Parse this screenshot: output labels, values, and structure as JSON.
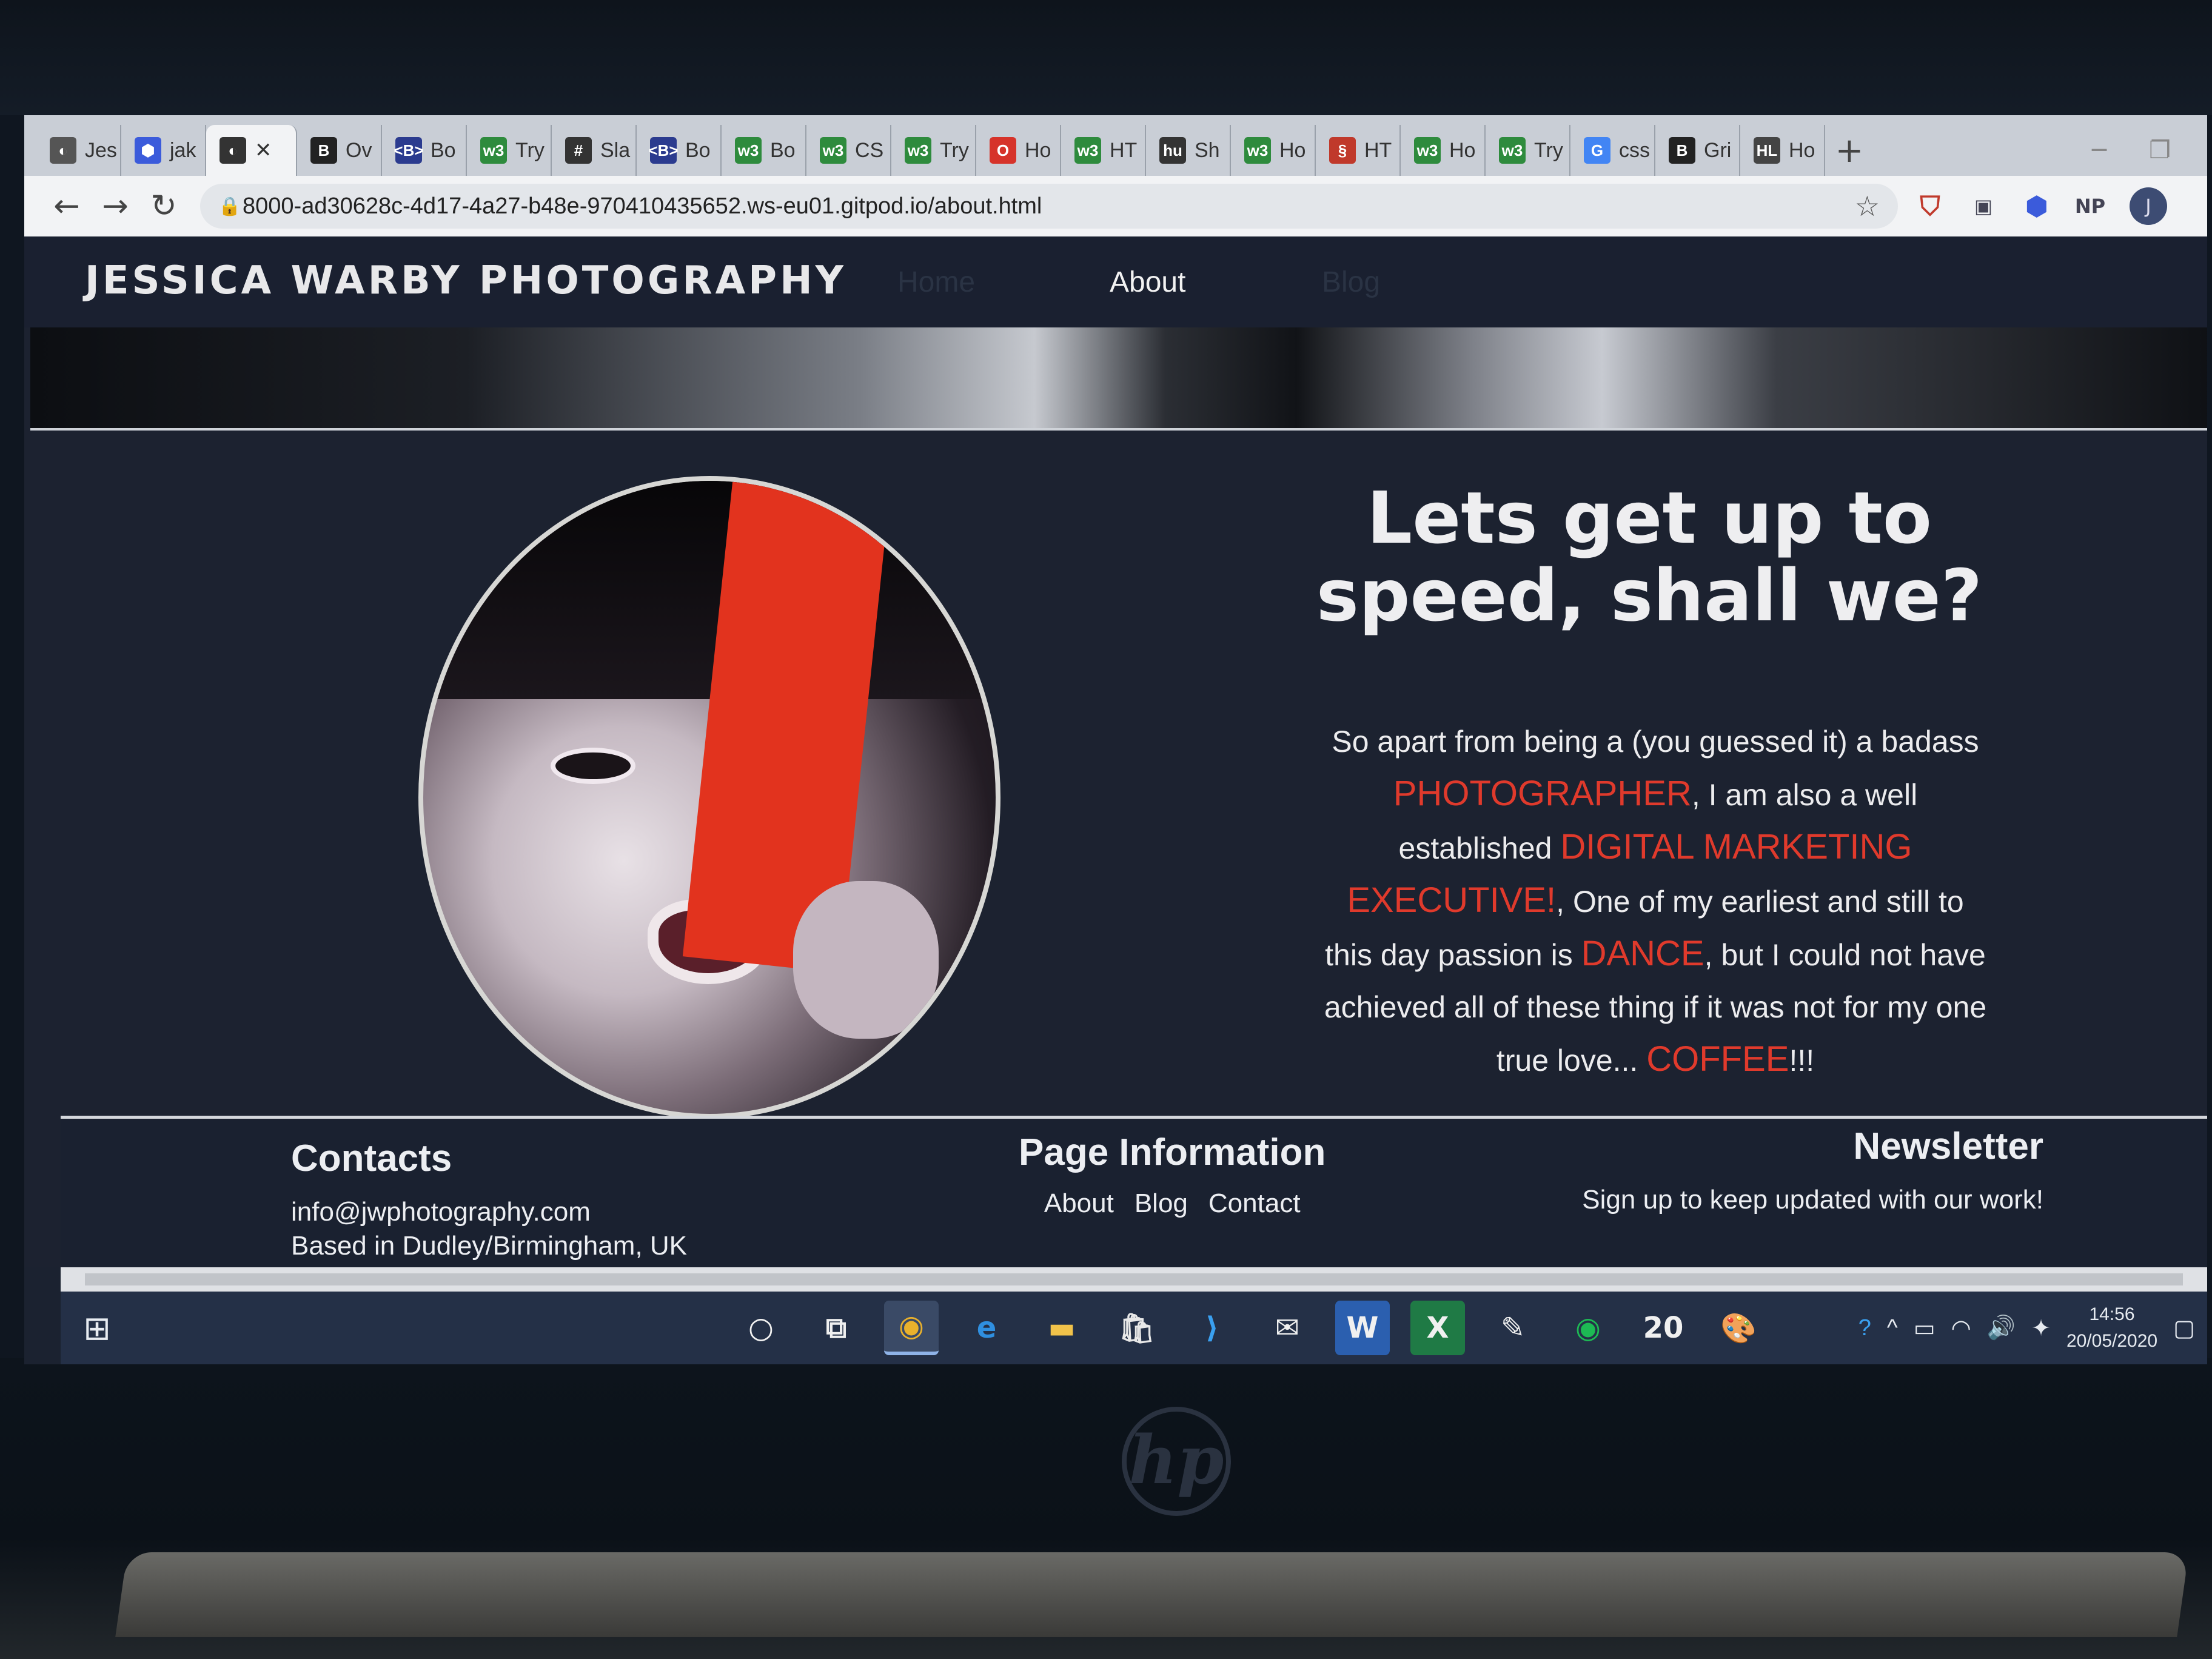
{
  "browser": {
    "tabs": [
      {
        "label": "Jes",
        "icon": "globe",
        "color": "#555555"
      },
      {
        "label": "jak",
        "icon": "hexagon",
        "color": "#3b5bdb"
      },
      {
        "label": "✕",
        "icon": "globe",
        "color": "#333333",
        "active": true
      },
      {
        "label": "Ov",
        "icon": "B",
        "color": "#222222"
      },
      {
        "label": "Bo",
        "icon": "<B>",
        "color": "#2b3b8f"
      },
      {
        "label": "Try",
        "icon": "w3",
        "color": "#2e8b3d"
      },
      {
        "label": "Sla",
        "icon": "#",
        "color": "#333333"
      },
      {
        "label": "Bo",
        "icon": "<B>",
        "color": "#2b3b8f"
      },
      {
        "label": "Bo",
        "icon": "w3",
        "color": "#2e8b3d"
      },
      {
        "label": "CS",
        "icon": "w3",
        "color": "#2e8b3d"
      },
      {
        "label": "Try",
        "icon": "w3",
        "color": "#2e8b3d"
      },
      {
        "label": "Ho",
        "icon": "O",
        "color": "#d6332a"
      },
      {
        "label": "HT",
        "icon": "w3",
        "color": "#2e8b3d"
      },
      {
        "label": "Sh",
        "icon": "hu",
        "color": "#333333"
      },
      {
        "label": "Ho",
        "icon": "w3",
        "color": "#2e8b3d"
      },
      {
        "label": "HT",
        "icon": "§",
        "color": "#c0392b"
      },
      {
        "label": "Ho",
        "icon": "w3",
        "color": "#2e8b3d"
      },
      {
        "label": "Try",
        "icon": "w3",
        "color": "#2e8b3d"
      },
      {
        "label": "css",
        "icon": "G",
        "color": "#4285f4"
      },
      {
        "label": "Gri",
        "icon": "B",
        "color": "#222222"
      },
      {
        "label": "Ho",
        "icon": "HL",
        "color": "#444444"
      }
    ],
    "new_tab": "+",
    "url": "8000-ad30628c-4d17-4a27-b48e-970410435652.ws-eu01.gitpod.io/about.html",
    "ext_np": "NP",
    "avatar": "J"
  },
  "site": {
    "brand": "JESSICA WARBY PHOTOGRAPHY",
    "nav": {
      "home": "Home",
      "about": "About",
      "blog": "Blog"
    },
    "headline": "Lets get up to speed, shall we?",
    "about": {
      "p1": "So apart from being a (you guessed it) a badass ",
      "h1": "PHOTOGRAPHER",
      "p2": ", I am also a well established ",
      "h2": "DIGITAL MARKETING EXECUTIVE!",
      "p3": ", One of my earliest and still to this day passion is ",
      "h3": "DANCE",
      "p4": ", but I could not have achieved all of these thing if it was not for my one true love... ",
      "h4": "COFFEE",
      "p5": "!!!"
    },
    "footer": {
      "contacts_title": "Contacts",
      "email": "info@jwphotography.com",
      "location": "Based in Dudley/Birmingham, UK",
      "page_info_title": "Page Information",
      "links": [
        "About",
        "Blog",
        "Contact"
      ],
      "newsletter_title": "Newsletter",
      "newsletter_text": "Sign up to keep updated with our work!"
    }
  },
  "taskbar": {
    "clock_time": "14:56",
    "clock_date": "20/05/2020",
    "badge_20": "20"
  },
  "colors": {
    "accent": "#e03a2c",
    "page_bg": "#1c2230"
  }
}
